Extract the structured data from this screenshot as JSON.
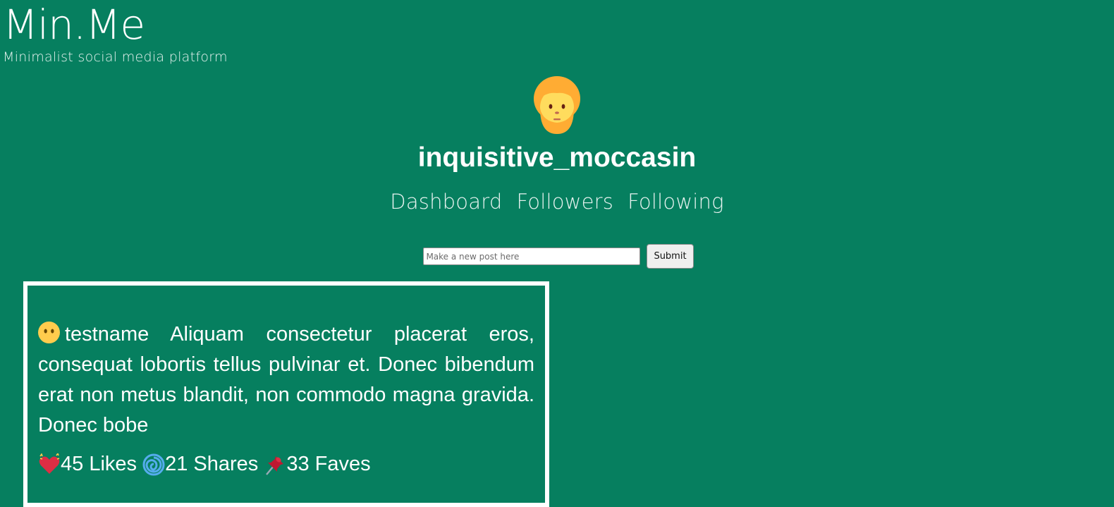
{
  "brand": {
    "title": "Min.Me",
    "subtitle": "Minimalist social media platform"
  },
  "profile": {
    "avatar_icon": "bearded-person-emoji",
    "username": "inquisitive_moccasin"
  },
  "nav": {
    "items": [
      {
        "label": "Dashboard"
      },
      {
        "label": "Followers"
      },
      {
        "label": "Following"
      }
    ]
  },
  "post_form": {
    "placeholder": "Make a new post here",
    "value": "",
    "submit_label": "Submit"
  },
  "post": {
    "author_icon": "face-without-mouth-emoji",
    "author": "testname",
    "body": "Aliquam consectetur placerat eros, consequat lobortis tellus pulvinar et. Donec bibendum erat non metus blandit, non commodo magna gravida. Donec bobe",
    "likes_icon": "sparkling-heart-emoji",
    "likes": "45 Likes",
    "shares_icon": "cyclone-emoji",
    "shares": "21 Shares",
    "faves_icon": "pushpin-emoji",
    "faves": "33 Faves"
  },
  "colors": {
    "background": "#067f5f",
    "text": "#ffffff"
  }
}
